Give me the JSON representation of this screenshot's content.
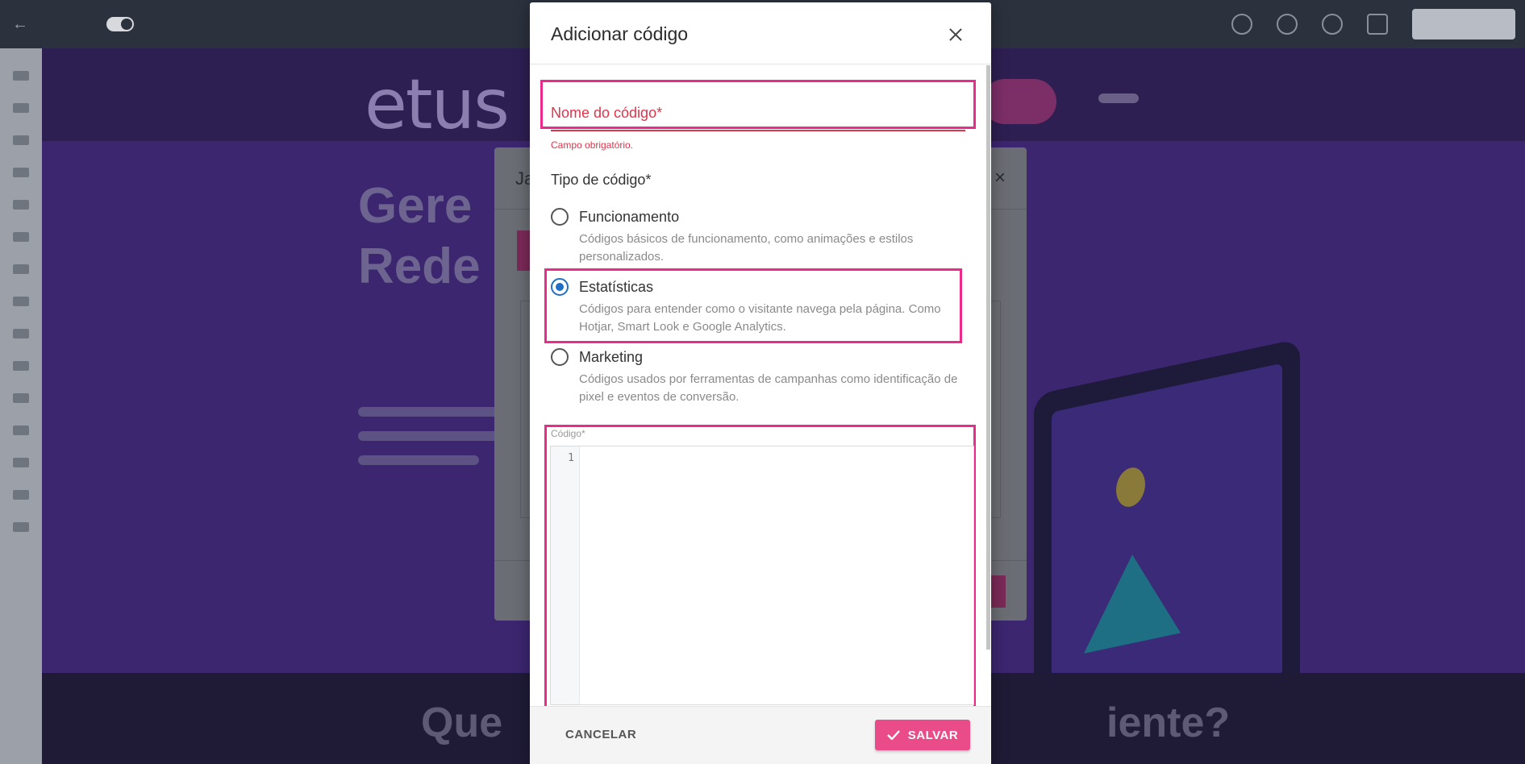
{
  "modal": {
    "title": "Adicionar código",
    "name_field": {
      "label": "Nome do código*",
      "value": "",
      "error": "Campo obrigatório."
    },
    "type_field": {
      "label": "Tipo de código*",
      "selected": "Estatísticas",
      "options": [
        {
          "title": "Funcionamento",
          "description": "Códigos básicos de funcionamento, como animações e estilos personalizados.",
          "checked": false
        },
        {
          "title": "Estatísticas",
          "description": "Códigos para entender como o visitante navega pela página. Como Hotjar, Smart Look e Google Analytics.",
          "checked": true
        },
        {
          "title": "Marketing",
          "description": "Códigos usados por ferramentas de campanhas como identificação de pixel e eventos de conversão.",
          "checked": false
        }
      ]
    },
    "code_field": {
      "label": "Código*",
      "line_number": "1",
      "value": ""
    },
    "footer": {
      "cancel_label": "CANCELAR",
      "save_label": "SALVAR"
    }
  },
  "colors": {
    "accent": "#ea4c89",
    "highlight": "#ea2b8b",
    "error": "#e0344a",
    "radio_selected": "#1f6fc7"
  },
  "background_page": {
    "brand": "etus",
    "dialog_title_fragment": "Ja",
    "headline_fragment_1": "Gere",
    "headline_fragment_2": "Rede",
    "footer_fragment_1": "Que",
    "footer_fragment_2": "iente?"
  }
}
